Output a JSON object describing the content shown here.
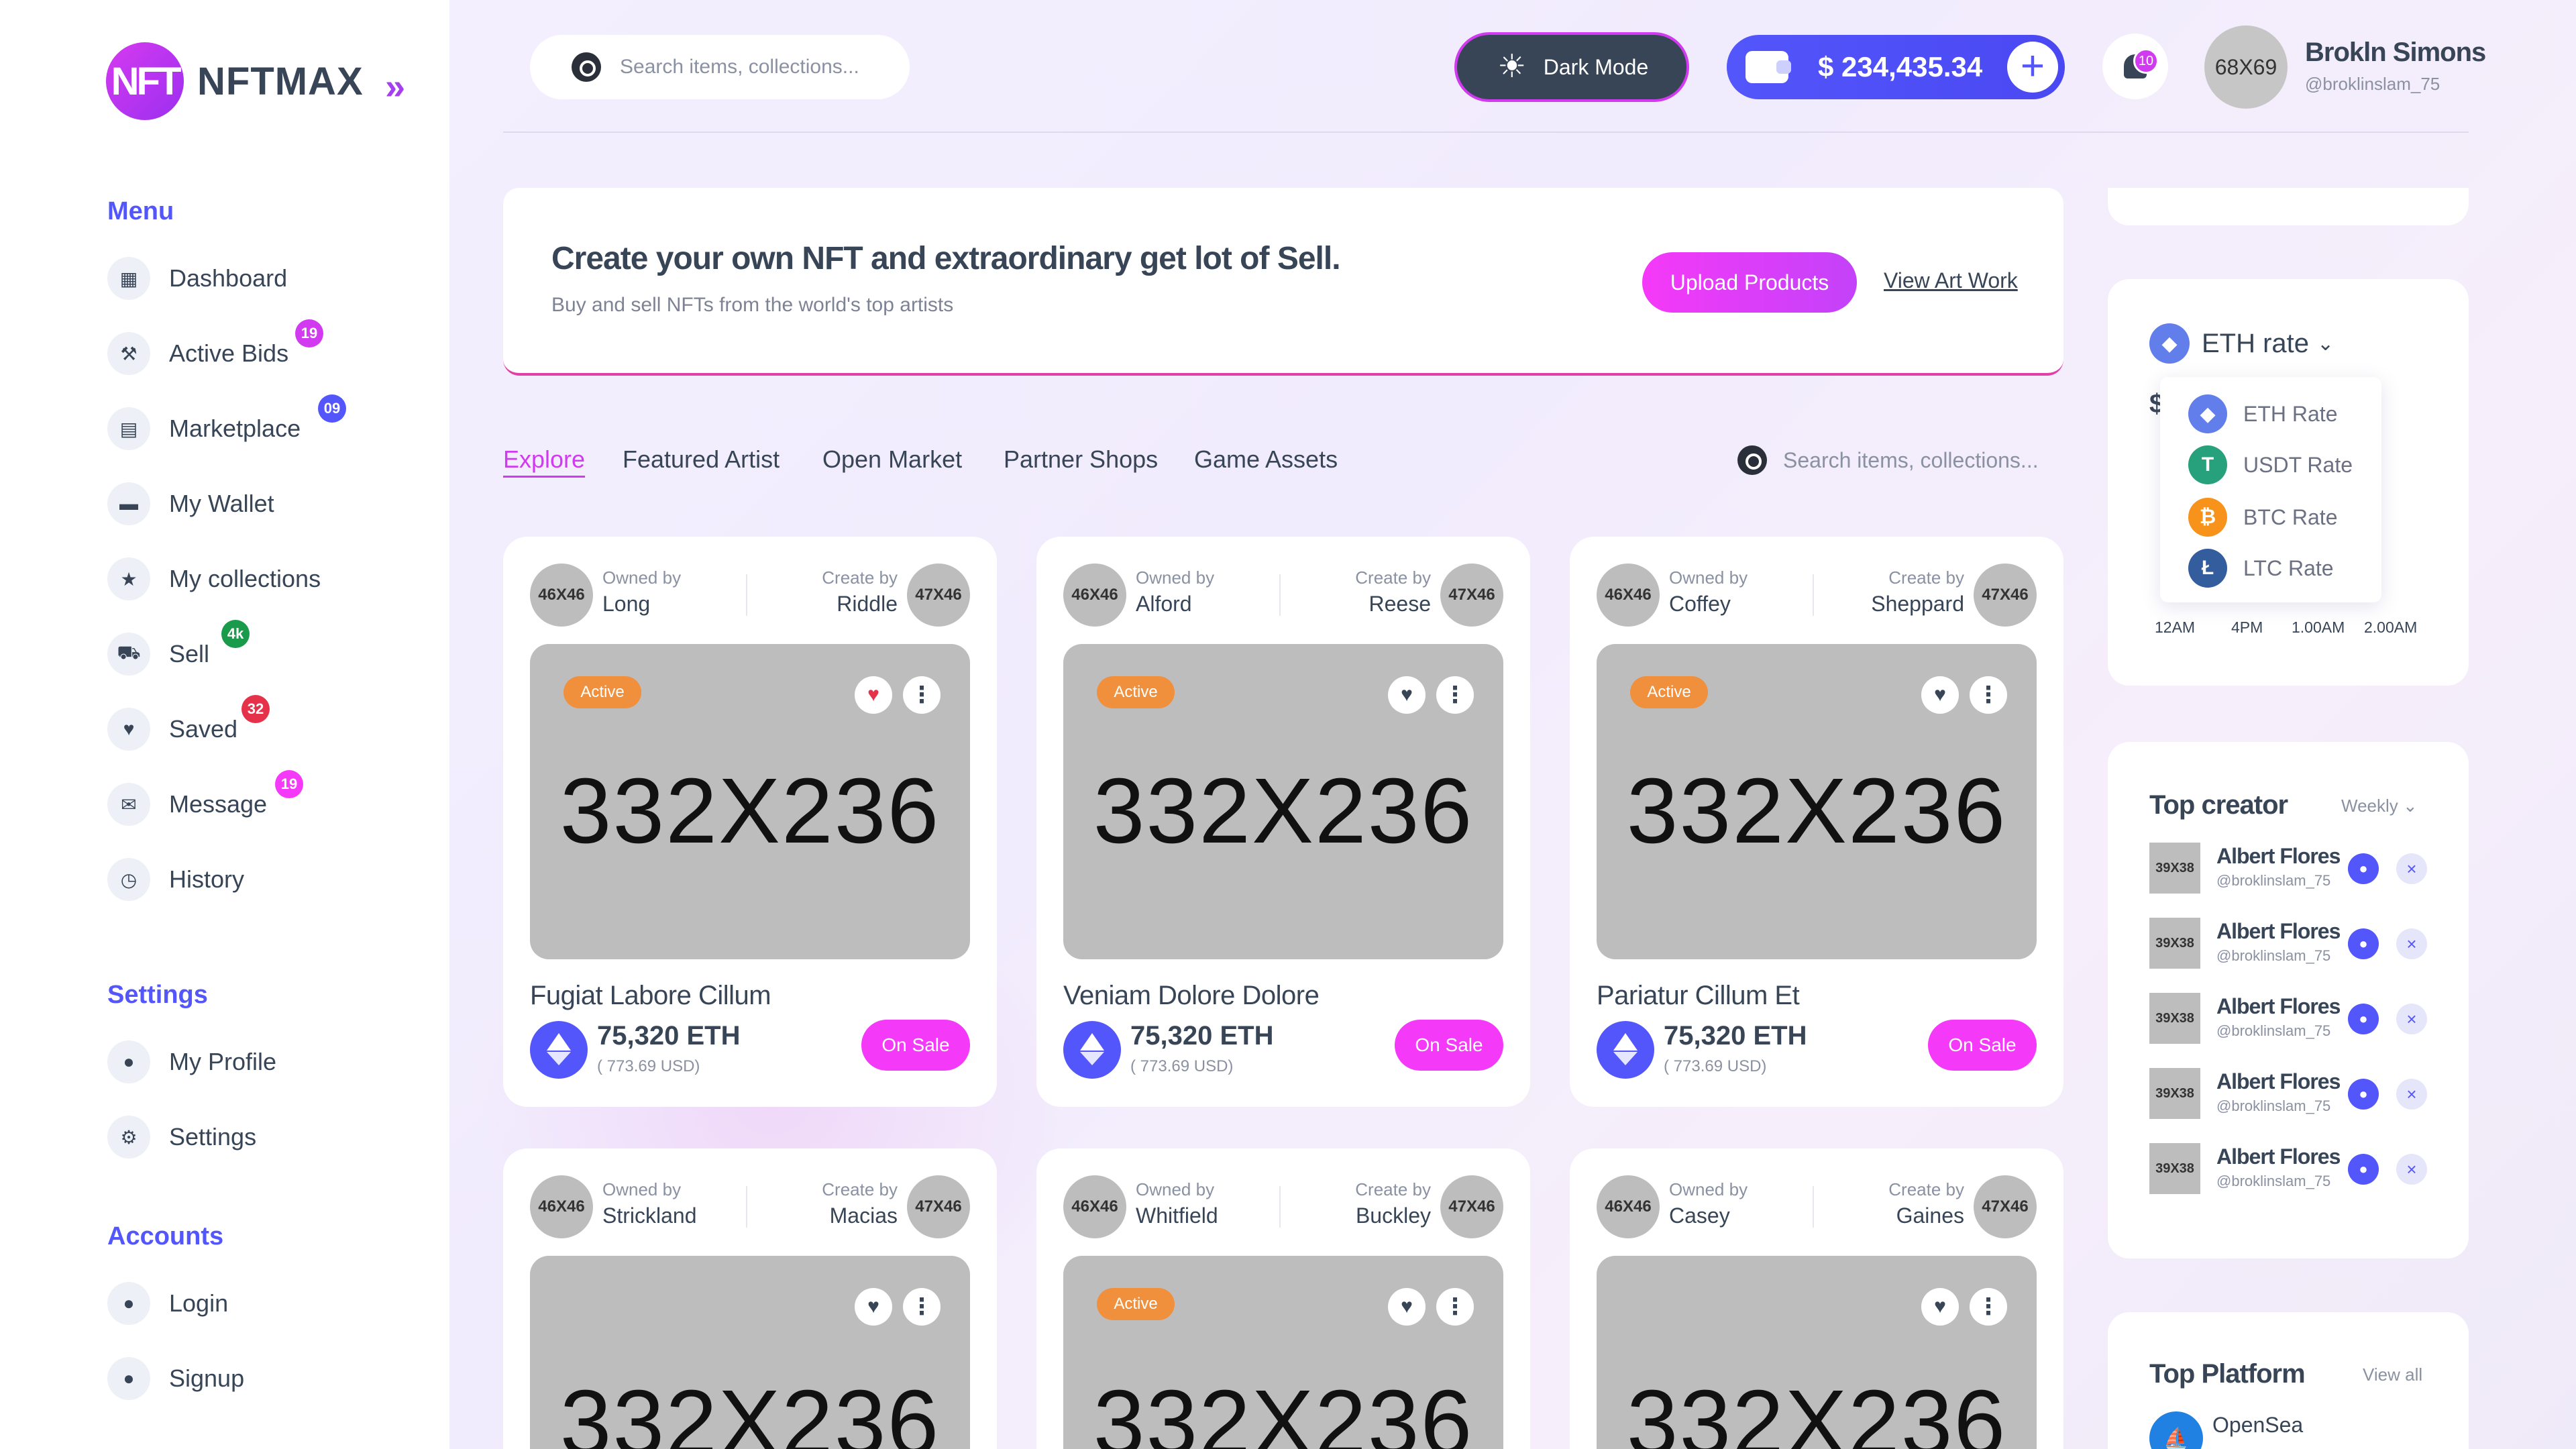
{
  "brand": {
    "logo_mark": "NFT",
    "name": "NFTMAX",
    "accent": "#d13af0",
    "primary": "#5356fb"
  },
  "sidebar": {
    "menu_title": "Menu",
    "menu": [
      {
        "label": "Dashboard",
        "icon": "grid-icon",
        "badge": ""
      },
      {
        "label": "Active Bids",
        "icon": "gavel-icon",
        "badge": "19",
        "badge_color": "#d13af0"
      },
      {
        "label": "Marketplace",
        "icon": "store-icon",
        "badge": "09",
        "badge_color": "#5356fb"
      },
      {
        "label": "My Wallet",
        "icon": "wallet-icon",
        "badge": ""
      },
      {
        "label": "My collections",
        "icon": "star-icon",
        "badge": ""
      },
      {
        "label": "Sell",
        "icon": "cart-icon",
        "badge": "4k",
        "badge_color": "#1a9b4b"
      },
      {
        "label": "Saved",
        "icon": "heart-icon",
        "badge": "32",
        "badge_color": "#e5324a"
      },
      {
        "label": "Message",
        "icon": "mail-icon",
        "badge": "19",
        "badge_color": "#f539f8"
      },
      {
        "label": "History",
        "icon": "clock-icon",
        "badge": ""
      }
    ],
    "settings_title": "Settings",
    "settings": [
      {
        "label": "My Profile",
        "icon": "user-icon"
      },
      {
        "label": "Settings",
        "icon": "gear-icon"
      }
    ],
    "accounts_title": "Accounts",
    "accounts": [
      {
        "label": "Login",
        "icon": "user-icon"
      },
      {
        "label": "Signup",
        "icon": "user-icon"
      }
    ]
  },
  "header": {
    "search_placeholder": "Search items, collections...",
    "dark_mode_label": "Dark Mode",
    "wallet_balance": "$ 234,435.34",
    "notification_count": "10",
    "avatar_label": "68X69",
    "user_name": "Brokln Simons",
    "user_handle": "@broklinslam_75"
  },
  "banner": {
    "title": "Create your own NFT and extraordinary get lot of Sell.",
    "subtitle": "Buy and sell NFTs from the world's top artists",
    "upload_label": "Upload Products",
    "view_label": "View Art Work"
  },
  "tabs": {
    "items": [
      "Explore",
      "Featured Artist",
      "Open Market",
      "Partner Shops",
      "Game Assets"
    ],
    "active": "Explore",
    "search_placeholder": "Search items, collections..."
  },
  "cards": [
    {
      "owner_av": "46X46",
      "owned_label": "Owned by",
      "owner": "Long",
      "create_label": "Create by",
      "creator": "Riddle",
      "creator_av": "47X46",
      "image": "332X236",
      "status": "Active",
      "liked": true,
      "title": "Fugiat Labore Cillum",
      "price": "75,320 ETH",
      "usd": "( 773.69 USD)",
      "sale": "On Sale"
    },
    {
      "owner_av": "46X46",
      "owned_label": "Owned by",
      "owner": "Alford",
      "create_label": "Create by",
      "creator": "Reese",
      "creator_av": "47X46",
      "image": "332X236",
      "status": "Active",
      "liked": false,
      "title": "Veniam Dolore Dolore",
      "price": "75,320 ETH",
      "usd": "( 773.69 USD)",
      "sale": "On Sale"
    },
    {
      "owner_av": "46X46",
      "owned_label": "Owned by",
      "owner": "Coffey",
      "create_label": "Create by",
      "creator": "Sheppard",
      "creator_av": "47X46",
      "image": "332X236",
      "status": "Active",
      "liked": false,
      "title": "Pariatur Cillum Et",
      "price": "75,320 ETH",
      "usd": "( 773.69 USD)",
      "sale": "On Sale"
    },
    {
      "owner_av": "46X46",
      "owned_label": "Owned by",
      "owner": "Strickland",
      "create_label": "Create by",
      "creator": "Macias",
      "creator_av": "47X46",
      "image": "332X236",
      "status": "",
      "liked": false
    },
    {
      "owner_av": "46X46",
      "owned_label": "Owned by",
      "owner": "Whitfield",
      "create_label": "Create by",
      "creator": "Buckley",
      "creator_av": "47X46",
      "image": "332X236",
      "status": "Active",
      "liked": false
    },
    {
      "owner_av": "46X46",
      "owned_label": "Owned by",
      "owner": "Casey",
      "create_label": "Create by",
      "creator": "Gaines",
      "creator_av": "47X46",
      "image": "332X236",
      "status": "",
      "liked": false
    }
  ],
  "eth_rate": {
    "title": "ETH rate",
    "value_prefix": "$",
    "options": [
      {
        "label": "ETH Rate",
        "icon": "eth-icon",
        "color": "#627eea"
      },
      {
        "label": "USDT Rate",
        "icon": "usdt-icon",
        "color": "#26a17b"
      },
      {
        "label": "BTC Rate",
        "icon": "btc-icon",
        "color": "#f7931a"
      },
      {
        "label": "LTC Rate",
        "icon": "ltc-icon",
        "color": "#345d9d"
      }
    ],
    "times": [
      "12AM",
      "4PM",
      "1.00AM",
      "2.00AM"
    ]
  },
  "top_creator": {
    "title": "Top creator",
    "period": "Weekly",
    "items": [
      {
        "avatar": "39X38",
        "name": "Albert Flores",
        "handle": "@broklinslam_75"
      },
      {
        "avatar": "39X38",
        "name": "Albert Flores",
        "handle": "@broklinslam_75"
      },
      {
        "avatar": "39X38",
        "name": "Albert Flores",
        "handle": "@broklinslam_75"
      },
      {
        "avatar": "39X38",
        "name": "Albert Flores",
        "handle": "@broklinslam_75"
      },
      {
        "avatar": "39X38",
        "name": "Albert Flores",
        "handle": "@broklinslam_75"
      }
    ]
  },
  "top_platform": {
    "title": "Top Platform",
    "view_all": "View all",
    "first": "OpenSea"
  }
}
